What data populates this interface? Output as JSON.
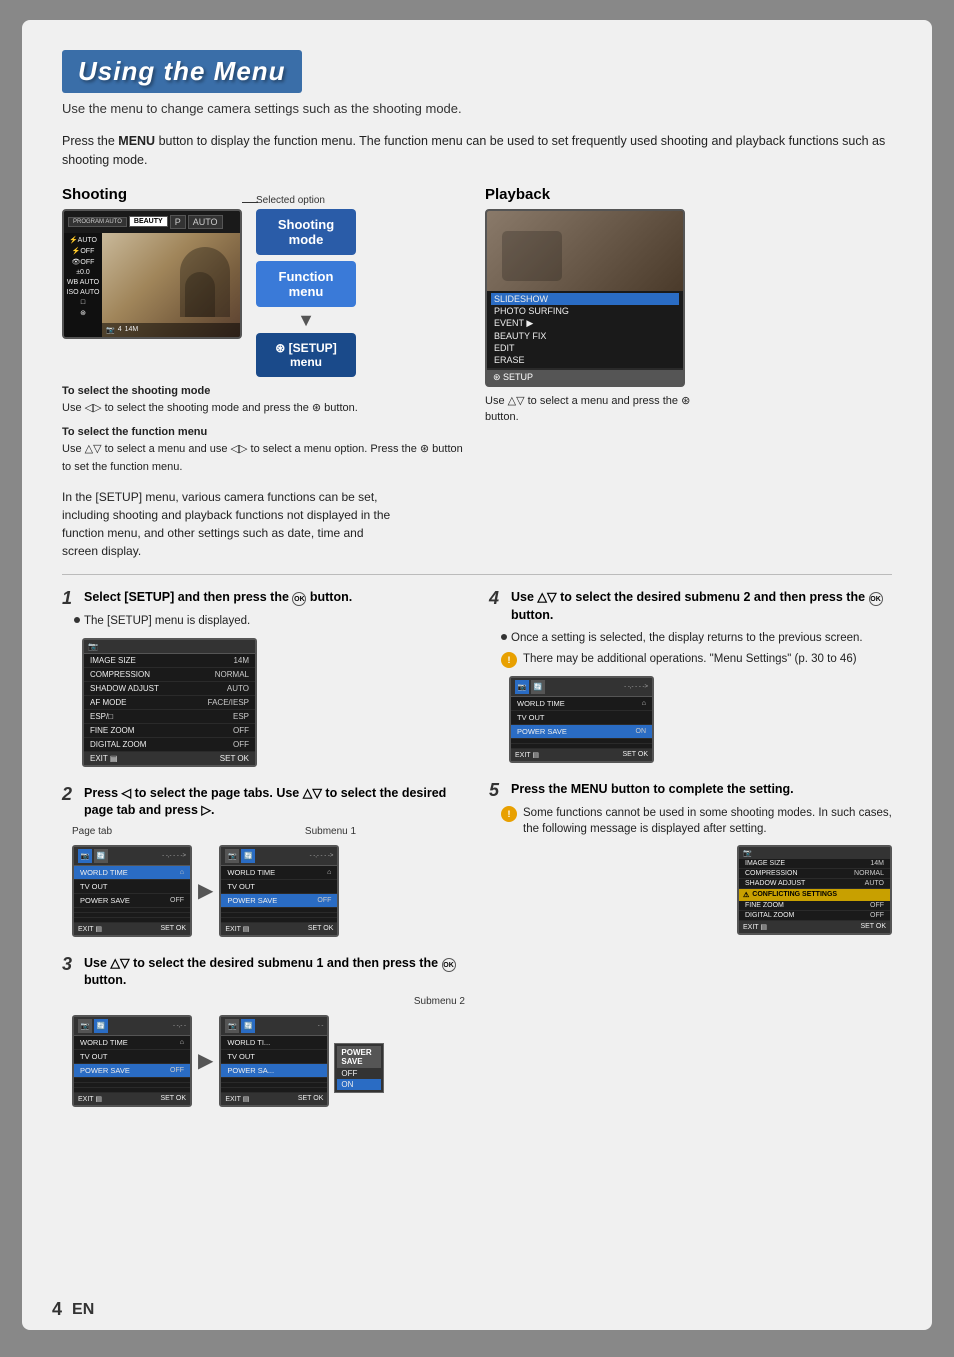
{
  "page": {
    "title": "Using the Menu",
    "subtitle": "Use the menu to change camera settings such as the shooting mode.",
    "intro": "Press the <strong>MENU</strong> button to display the function menu. The function menu can be used to set frequently used shooting and playback functions such as shooting mode.",
    "page_number": "4",
    "en_label": "EN"
  },
  "diagram": {
    "shooting_label": "Shooting",
    "playback_label": "Playback",
    "selected_option": "Selected option",
    "camera_modes": [
      "PROGRAM AUTO",
      "BEAUTY",
      "P",
      "AUTO"
    ],
    "menu_items": [
      {
        "label": "Shooting mode",
        "active": true
      },
      {
        "label": "Function menu",
        "active": false
      },
      {
        "label": "⊛ [SETUP] menu",
        "active": false
      }
    ],
    "playback_items": [
      "SLIDESHOW",
      "PHOTO SURFING",
      "EVENT ▶",
      "BEAUTY FIX",
      "EDIT",
      "ERASE"
    ],
    "setup_label": "⊛ SETUP",
    "to_select_shooting": "To select the shooting mode",
    "shooting_instruction": "Use ◁▷ to select the shooting mode and press the ⊛ button.",
    "to_select_function": "To select the function menu",
    "function_instruction": "Use △▽ to select a menu and use ◁▷ to select a menu option. Press the ⊛ button to set the function menu.",
    "setup_desc": "In the [SETUP] menu, various camera functions can be set, including shooting and playback functions not displayed in the function menu, and other settings such as date, time and screen display.",
    "playback_use": "Use △▽ to select a menu and press the ⊛ button."
  },
  "steps": [
    {
      "number": "1",
      "instruction": "Select [SETUP] and then press the ⊛ button.",
      "bullets": [
        "The [SETUP] menu is displayed."
      ],
      "info": null
    },
    {
      "number": "2",
      "instruction": "Press ◁ to select the page tabs. Use △▽ to select the desired page tab and press ▷.",
      "page_tab_label": "Page tab",
      "submenu1_label": "Submenu 1",
      "bullets": [],
      "info": null
    },
    {
      "number": "3",
      "instruction": "Use △▽ to select the desired submenu 1 and then press the ⊛ button.",
      "submenu2_label": "Submenu 2",
      "bullets": [],
      "info": null
    },
    {
      "number": "4",
      "instruction": "Use △▽ to select the desired submenu 2 and then press the ⊛ button.",
      "bullets": [
        "Once a setting is selected, the display returns to the previous screen."
      ],
      "info": "There may be additional operations. \"Menu Settings\" (p. 30 to 46)"
    },
    {
      "number": "5",
      "instruction": "Press the MENU button to complete the setting.",
      "bullets": [],
      "info": "Some functions cannot be used in some shooting modes. In such cases, the following message is displayed after setting."
    }
  ],
  "menu_screen_main": {
    "rows": [
      {
        "label": "IMAGE SIZE",
        "value": "14M",
        "selected": false
      },
      {
        "label": "COMPRESSION",
        "value": "NORMAL",
        "selected": false
      },
      {
        "label": "SHADOW ADJUST",
        "value": "AUTO",
        "selected": false
      },
      {
        "label": "AF MODE",
        "value": "FACE/IESP",
        "selected": false
      },
      {
        "label": "ESP/□",
        "value": "ESP",
        "selected": false
      },
      {
        "label": "FINE ZOOM",
        "value": "OFF",
        "selected": false
      },
      {
        "label": "DIGITAL ZOOM",
        "value": "OFF",
        "selected": false
      }
    ],
    "footer_exit": "EXIT",
    "footer_set": "SET"
  },
  "nav_screen_left": {
    "rows": [
      {
        "label": "WORLD TIME",
        "value": "⌂",
        "selected": false
      },
      {
        "label": "TV OUT",
        "value": "",
        "selected": false
      },
      {
        "label": "POWER SAVE",
        "value": "OFF",
        "selected": false
      },
      {
        "label": "",
        "value": "",
        "selected": false
      },
      {
        "label": "",
        "value": "",
        "selected": false
      },
      {
        "label": "",
        "value": "",
        "selected": false
      }
    ],
    "footer_exit": "EXIT",
    "footer_set": "SET"
  },
  "nav_screen_right": {
    "rows": [
      {
        "label": "WORLD TIME",
        "value": "⌂",
        "selected": false
      },
      {
        "label": "TV OUT",
        "value": "",
        "selected": false
      },
      {
        "label": "POWER SAVE",
        "value": "OFF",
        "selected": true
      },
      {
        "label": "",
        "value": "",
        "selected": false
      },
      {
        "label": "",
        "value": "",
        "selected": false
      },
      {
        "label": "",
        "value": "",
        "selected": false
      }
    ],
    "footer_exit": "EXIT",
    "footer_set": "SET"
  },
  "nav_screen_step3_left": {
    "rows": [
      {
        "label": "WORLD TIME",
        "value": "⌂",
        "selected": false
      },
      {
        "label": "TV OUT",
        "value": "",
        "selected": false
      },
      {
        "label": "POWER SAVE",
        "value": "OFF",
        "selected": false
      },
      {
        "label": "",
        "value": "",
        "selected": false
      },
      {
        "label": "",
        "value": "",
        "selected": false
      },
      {
        "label": "",
        "value": "",
        "selected": false
      }
    ]
  },
  "nav_screen_step3_right": {
    "submenu2_options": [
      "POWER SAVE",
      "OFF",
      "ON"
    ],
    "rows": [
      {
        "label": "WORLD TIME",
        "value": "⌂",
        "selected": false
      },
      {
        "label": "TV OUT",
        "value": "",
        "selected": false
      },
      {
        "label": "POWER SAVE",
        "value": "OFF",
        "selected": true
      },
      {
        "label": "",
        "value": "",
        "selected": false
      },
      {
        "label": "",
        "value": "",
        "selected": false
      },
      {
        "label": "",
        "value": "",
        "selected": false
      }
    ]
  },
  "step4_nav_screen": {
    "rows": [
      {
        "label": "WORLD TIME",
        "value": "⌂",
        "selected": false
      },
      {
        "label": "TV OUT",
        "value": "",
        "selected": false
      },
      {
        "label": "POWER SAVE",
        "value": "ON",
        "selected": true
      },
      {
        "label": "",
        "value": "",
        "selected": false
      },
      {
        "label": "",
        "value": "",
        "selected": false
      }
    ]
  },
  "conflict_screen": {
    "rows": [
      {
        "label": "IMAGE SIZE",
        "value": "14M",
        "type": "normal"
      },
      {
        "label": "COMPRESSION",
        "value": "NORMAL",
        "type": "normal"
      },
      {
        "label": "SHADOW ADJUST",
        "value": "AUTO",
        "type": "normal"
      },
      {
        "label": "CONFLICTING SETTINGS",
        "value": "",
        "type": "warning"
      },
      {
        "label": "FINE ZOOM",
        "value": "OFF",
        "type": "normal"
      },
      {
        "label": "DIGITAL ZOOM",
        "value": "OFF",
        "type": "normal"
      }
    ]
  }
}
